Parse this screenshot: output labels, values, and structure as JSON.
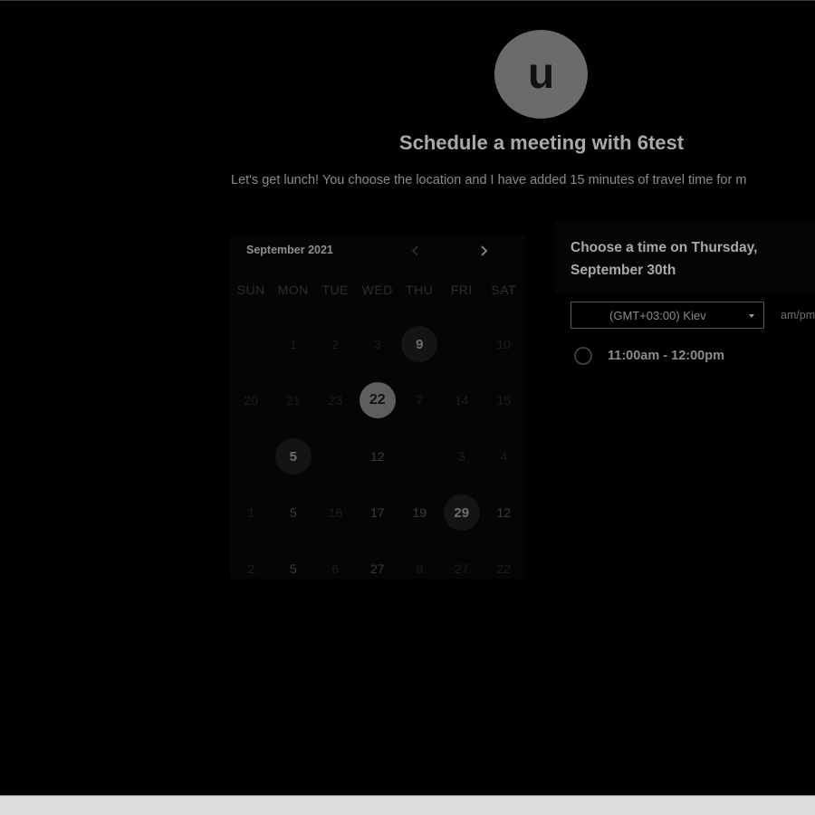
{
  "profile": {
    "avatar_letter": "u",
    "title": "Schedule a meeting with 6test",
    "description": "Let's get lunch! You choose the location and I have added 15 minutes of travel time for m"
  },
  "calendar": {
    "month_label": "September 2021",
    "weekdays": [
      "SUN",
      "MON",
      "TUE",
      "WED",
      "THU",
      "FRI",
      "SAT"
    ],
    "weeks": [
      [
        "",
        "1",
        "2",
        "3",
        "9",
        "",
        "10"
      ],
      [
        "20",
        "21",
        "23",
        "22",
        "7",
        "14",
        "15"
      ],
      [
        "",
        "5",
        "",
        "12",
        "",
        "3",
        "4"
      ],
      [
        "1",
        "5",
        "16",
        "17",
        "19",
        "29",
        "12"
      ],
      [
        "2",
        "5",
        "6",
        "27",
        "8",
        "27",
        "22"
      ]
    ],
    "available_days": [
      "9",
      "5",
      "29"
    ],
    "selected_day": "22"
  },
  "times": {
    "heading": "Choose a time on Thursday, September 30th",
    "timezone": "(GMT+03:00) Kiev",
    "format_toggle": "am/pm",
    "slots": [
      "11:00am - 12:00pm"
    ]
  },
  "colors": {
    "background": "#000000",
    "avatar": "#6b6b6b",
    "selected_day": "#5e5e5e",
    "bottom_bar": "#dcdcdc"
  }
}
